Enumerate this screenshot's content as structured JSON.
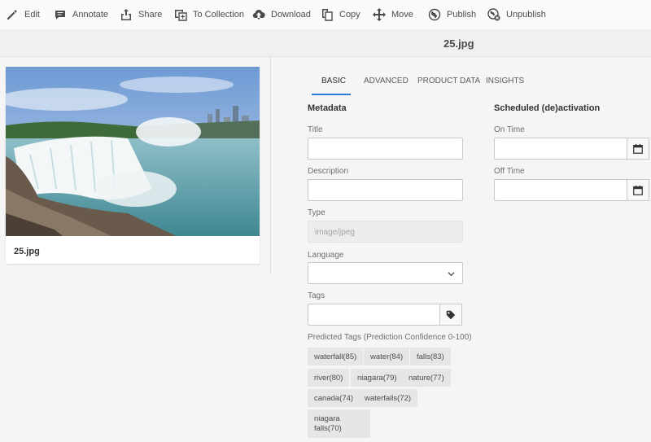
{
  "toolbar": {
    "items": [
      {
        "label": "Edit",
        "icon": "pencil-icon"
      },
      {
        "label": "Annotate",
        "icon": "comment-icon"
      },
      {
        "label": "Share",
        "icon": "share-icon"
      },
      {
        "label": "To Collection",
        "icon": "collection-icon"
      },
      {
        "label": "Download",
        "icon": "cloud-download-icon"
      },
      {
        "label": "Copy",
        "icon": "copy-icon"
      },
      {
        "label": "Move",
        "icon": "move-icon"
      },
      {
        "label": "Publish",
        "icon": "globe-icon"
      },
      {
        "label": "Unpublish",
        "icon": "globe-remove-icon"
      }
    ]
  },
  "header": {
    "filename": "25.jpg"
  },
  "asset_card": {
    "caption": "25.jpg"
  },
  "tabs": [
    "BASIC",
    "ADVANCED",
    "PRODUCT DATA",
    "INSIGHTS"
  ],
  "active_tab": "BASIC",
  "metadata": {
    "heading": "Metadata",
    "title_label": "Title",
    "title_value": "",
    "description_label": "Description",
    "description_value": "",
    "type_label": "Type",
    "type_value": "image/jpeg",
    "language_label": "Language",
    "language_value": "",
    "tags_label": "Tags",
    "tags_value": "",
    "predicted_label": "Predicted Tags (Prediction Confidence 0-100)",
    "predicted_tags": [
      "waterfall(85)",
      "water(84)",
      "falls(83)",
      "river(80)",
      "niagara(79)",
      "nature(77)",
      "canada(74)",
      "waterfalls(72)",
      "niagara falls(70)"
    ]
  },
  "schedule": {
    "heading": "Scheduled (de)activation",
    "on_label": "On Time",
    "off_label": "Off Time"
  },
  "colors": {
    "accent": "#2b7ad4",
    "background": "#f5f5f5"
  }
}
